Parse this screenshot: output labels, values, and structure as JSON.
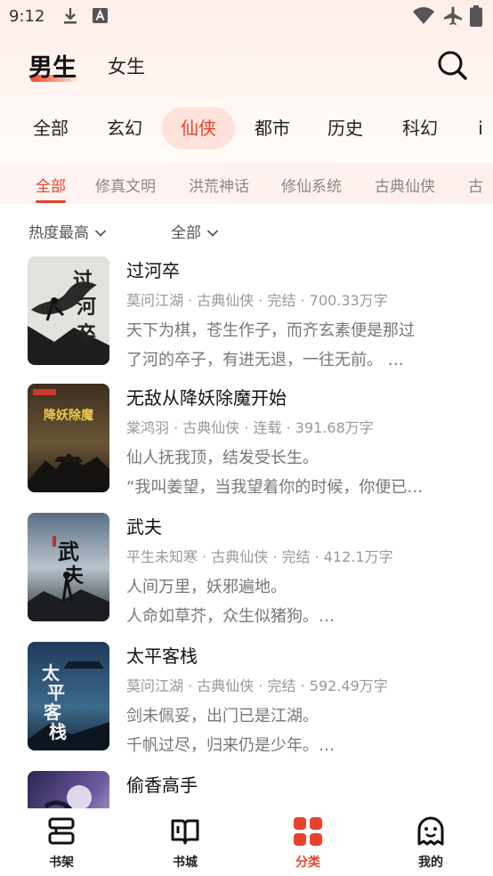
{
  "status_bar": {
    "time": "9:12"
  },
  "gender_tabs": {
    "male": "男生",
    "female": "女生"
  },
  "genres": [
    "全部",
    "玄幻",
    "仙侠",
    "都市",
    "历史",
    "科幻",
    "i"
  ],
  "subgenres": [
    "全部",
    "修真文明",
    "洪荒神话",
    "修仙系统",
    "古典仙侠",
    "古"
  ],
  "filters": {
    "sort": "热度最高",
    "status": "全部"
  },
  "books": [
    {
      "title": "过河卒",
      "meta": "莫问江湖 · 古典仙侠 · 完结 · 700.33万字",
      "desc1": "天下为棋，苍生作子，而齐玄素便是那过",
      "desc2": "了河的卒子，有进无退，一往无前。 …",
      "cover_text": "过河卒"
    },
    {
      "title": "无敌从降妖除魔开始",
      "meta": "棠鸿羽 · 古典仙侠 · 连载 · 391.68万字",
      "desc1": "仙人抚我顶，结发受长生。",
      "desc2": "“我叫姜望，当我望着你的时候，你便已…",
      "cover_text": "降妖除魔"
    },
    {
      "title": "武夫",
      "meta": "平生未知寒 · 古典仙侠 · 完结 · 412.1万字",
      "desc1": "人间万里，妖邪遍地。",
      "desc2": "人命如草芥，众生似猪狗。…",
      "cover_text": "武夫"
    },
    {
      "title": "太平客栈",
      "meta": "莫问江湖 · 古典仙侠 · 完结 · 592.49万字",
      "desc1": "剑未佩妥，出门已是江湖。",
      "desc2": "千帆过尽，归来仍是少年。…",
      "cover_text": "太平客栈"
    },
    {
      "title": "偷香高手",
      "meta": "",
      "desc1": "",
      "desc2": "",
      "cover_text": ""
    }
  ],
  "tabbar": [
    {
      "label": "书架",
      "icon": "bookshelf-icon"
    },
    {
      "label": "书城",
      "icon": "bookstore-icon"
    },
    {
      "label": "分类",
      "icon": "category-icon"
    },
    {
      "label": "我的",
      "icon": "profile-icon"
    }
  ],
  "colors": {
    "accent": "#e8432b",
    "accent_bg": "#fde3dc"
  }
}
